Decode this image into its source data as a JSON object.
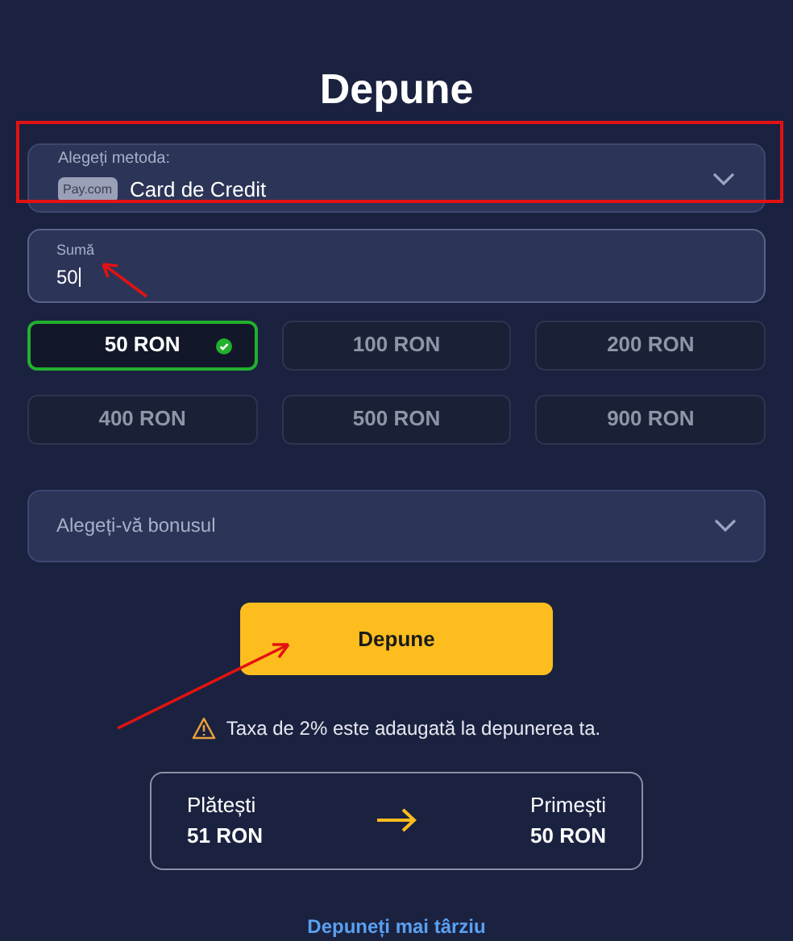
{
  "title": "Depune",
  "method": {
    "label": "Alegeți metoda:",
    "badge": "Pay.com",
    "value": "Card de Credit"
  },
  "amount_field": {
    "label": "Sumă",
    "value": "50"
  },
  "amounts": [
    {
      "label": "50 RON",
      "selected": true
    },
    {
      "label": "100 RON",
      "selected": false
    },
    {
      "label": "200 RON",
      "selected": false
    },
    {
      "label": "400 RON",
      "selected": false
    },
    {
      "label": "500 RON",
      "selected": false
    },
    {
      "label": "900 RON",
      "selected": false
    }
  ],
  "bonus": {
    "placeholder": "Alegeți-vă bonusul"
  },
  "submit": "Depune",
  "notice": "Taxa de 2% este adaugată la depunerea ta.",
  "summary": {
    "pay_label": "Plătești",
    "pay_value": "51 RON",
    "receive_label": "Primești",
    "receive_value": "50 RON"
  },
  "later_link": "Depuneți mai târziu"
}
